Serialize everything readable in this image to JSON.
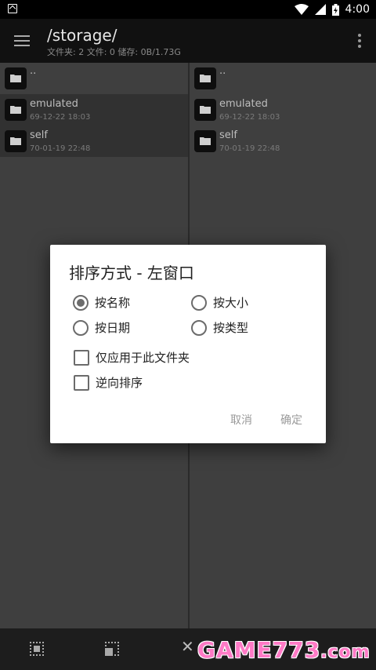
{
  "status_bar": {
    "time": "4:00"
  },
  "toolbar": {
    "title": "/storage/",
    "subtitle": "文件夹: 2  文件: 0  储存: 0B/1.73G"
  },
  "left_pane": {
    "items": [
      {
        "name": "..",
        "date": ""
      },
      {
        "name": "emulated",
        "date": "69-12-22 18:03"
      },
      {
        "name": "self",
        "date": "70-01-19 22:48"
      }
    ]
  },
  "right_pane": {
    "items": [
      {
        "name": "..",
        "date": ""
      },
      {
        "name": "emulated",
        "date": "69-12-22 18:03"
      },
      {
        "name": "self",
        "date": "70-01-19 22:48"
      }
    ]
  },
  "dialog": {
    "title": "排序方式 - 左窗口",
    "options": {
      "by_name": {
        "label": "按名称",
        "checked": true
      },
      "by_size": {
        "label": "按大小",
        "checked": false
      },
      "by_date": {
        "label": "按日期",
        "checked": false
      },
      "by_type": {
        "label": "按类型",
        "checked": false
      }
    },
    "checkboxes": {
      "this_folder_only": {
        "label": "仅应用于此文件夹",
        "checked": false
      },
      "reverse": {
        "label": "逆向排序",
        "checked": false
      }
    },
    "cancel_label": "取消",
    "ok_label": "确定"
  },
  "watermark": {
    "part1": "GAME773",
    "part2": ".com"
  }
}
